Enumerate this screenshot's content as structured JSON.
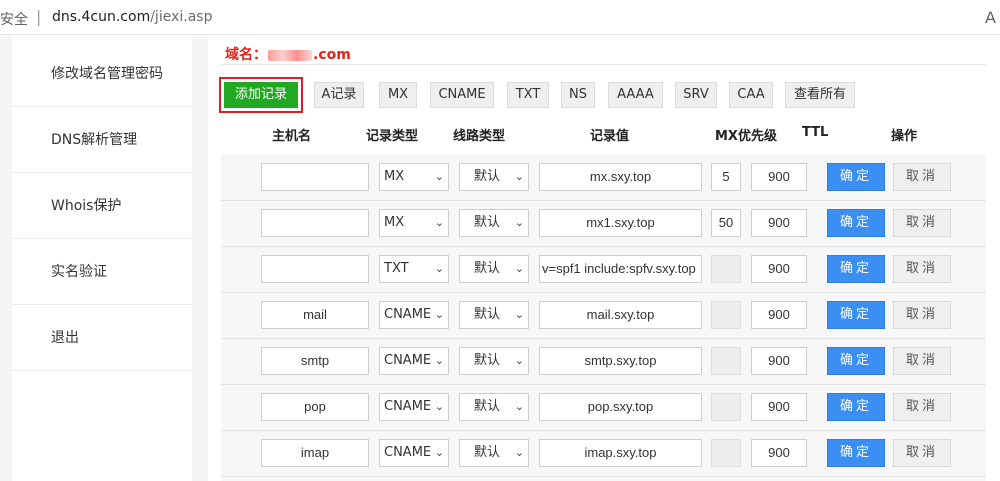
{
  "browser": {
    "secure_label": "安全",
    "separator": "|",
    "url_host": "dns.4cun.com",
    "url_path": "/jiexi.asp",
    "reader_icon": "A"
  },
  "sidebar": {
    "items": [
      {
        "label": "修改域名管理密码"
      },
      {
        "label": "DNS解析管理"
      },
      {
        "label": "Whois保护"
      },
      {
        "label": "实名验证"
      },
      {
        "label": "退出"
      }
    ]
  },
  "domain": {
    "label": "域名：",
    "suffix": ".com"
  },
  "toolbar": {
    "add_label": "添加记录",
    "type_buttons": [
      "A记录",
      "MX",
      "CNAME",
      "TXT",
      "NS",
      "AAAA",
      "SRV",
      "CAA",
      "查看所有"
    ]
  },
  "table": {
    "headers": [
      "主机名",
      "记录类型",
      "线路类型",
      "记录值",
      "MX优先级",
      "TTL",
      "操作"
    ],
    "confirm_label": "确定",
    "cancel_label": "取消",
    "rows": [
      {
        "host": "",
        "type": "MX",
        "line": "默认",
        "value": "mx.sxy.top",
        "mx": "5",
        "ttl": "900"
      },
      {
        "host": "",
        "type": "MX",
        "line": "默认",
        "value": "mx1.sxy.top",
        "mx": "50",
        "ttl": "900"
      },
      {
        "host": "",
        "type": "TXT",
        "line": "默认",
        "value": "v=spf1 include:spfv.sxy.top",
        "mx": "",
        "ttl": "900"
      },
      {
        "host": "mail",
        "type": "CNAME",
        "line": "默认",
        "value": "mail.sxy.top",
        "mx": "",
        "ttl": "900"
      },
      {
        "host": "smtp",
        "type": "CNAME",
        "line": "默认",
        "value": "smtp.sxy.top",
        "mx": "",
        "ttl": "900"
      },
      {
        "host": "pop",
        "type": "CNAME",
        "line": "默认",
        "value": "pop.sxy.top",
        "mx": "",
        "ttl": "900"
      },
      {
        "host": "imap",
        "type": "CNAME",
        "line": "默认",
        "value": "imap.sxy.top",
        "mx": "",
        "ttl": "900"
      }
    ]
  },
  "colors": {
    "add_button": "#22a822",
    "confirm_button": "#3b8ff3",
    "domain_label": "#e62117",
    "highlight_border": "#e02020"
  }
}
